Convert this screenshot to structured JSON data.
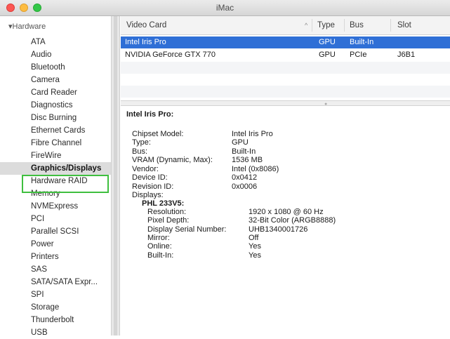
{
  "window": {
    "title": "iMac"
  },
  "sidebar": {
    "heading": "▾Hardware",
    "items": [
      {
        "label": "ATA"
      },
      {
        "label": "Audio"
      },
      {
        "label": "Bluetooth"
      },
      {
        "label": "Camera"
      },
      {
        "label": "Card Reader"
      },
      {
        "label": "Diagnostics"
      },
      {
        "label": "Disc Burning"
      },
      {
        "label": "Ethernet Cards"
      },
      {
        "label": "Fibre Channel"
      },
      {
        "label": "FireWire"
      },
      {
        "label": "Graphics/Displays"
      },
      {
        "label": "Hardware RAID"
      },
      {
        "label": "Memory"
      },
      {
        "label": "NVMExpress"
      },
      {
        "label": "PCI"
      },
      {
        "label": "Parallel SCSI"
      },
      {
        "label": "Power"
      },
      {
        "label": "Printers"
      },
      {
        "label": "SAS"
      },
      {
        "label": "SATA/SATA Expr..."
      },
      {
        "label": "SPI"
      },
      {
        "label": "Storage"
      },
      {
        "label": "Thunderbolt"
      },
      {
        "label": "USB"
      }
    ],
    "selected_index": 10
  },
  "table": {
    "columns": [
      "Video Card",
      "Type",
      "Bus",
      "Slot"
    ],
    "rows": [
      {
        "name": "Intel Iris Pro",
        "type": "GPU",
        "bus": "Built-In",
        "slot": ""
      },
      {
        "name": "NVIDIA GeForce GTX 770",
        "type": "GPU",
        "bus": "PCIe",
        "slot": "J6B1"
      }
    ],
    "selected_row": 0
  },
  "detail": {
    "title": "Intel Iris Pro:",
    "fields": [
      {
        "label": "Chipset Model:",
        "value": "Intel Iris Pro"
      },
      {
        "label": "Type:",
        "value": "GPU"
      },
      {
        "label": "Bus:",
        "value": "Built-In"
      },
      {
        "label": "VRAM (Dynamic, Max):",
        "value": "1536 MB"
      },
      {
        "label": "Vendor:",
        "value": "Intel (0x8086)"
      },
      {
        "label": "Device ID:",
        "value": "0x0412"
      },
      {
        "label": "Revision ID:",
        "value": "0x0006"
      },
      {
        "label": "Displays:",
        "value": ""
      }
    ],
    "display_name": "PHL 233V5:",
    "display_fields": [
      {
        "label": "Resolution:",
        "value": "1920 x 1080 @ 60 Hz"
      },
      {
        "label": "Pixel Depth:",
        "value": "32-Bit Color (ARGB8888)"
      },
      {
        "label": "Display Serial Number:",
        "value": "UHB1340001726"
      },
      {
        "label": "Mirror:",
        "value": "Off"
      },
      {
        "label": "Online:",
        "value": "Yes"
      },
      {
        "label": "Built-In:",
        "value": "Yes"
      }
    ]
  },
  "colors": {
    "selection": "#2f6fd6",
    "highlight_box": "#3fbf3f"
  }
}
